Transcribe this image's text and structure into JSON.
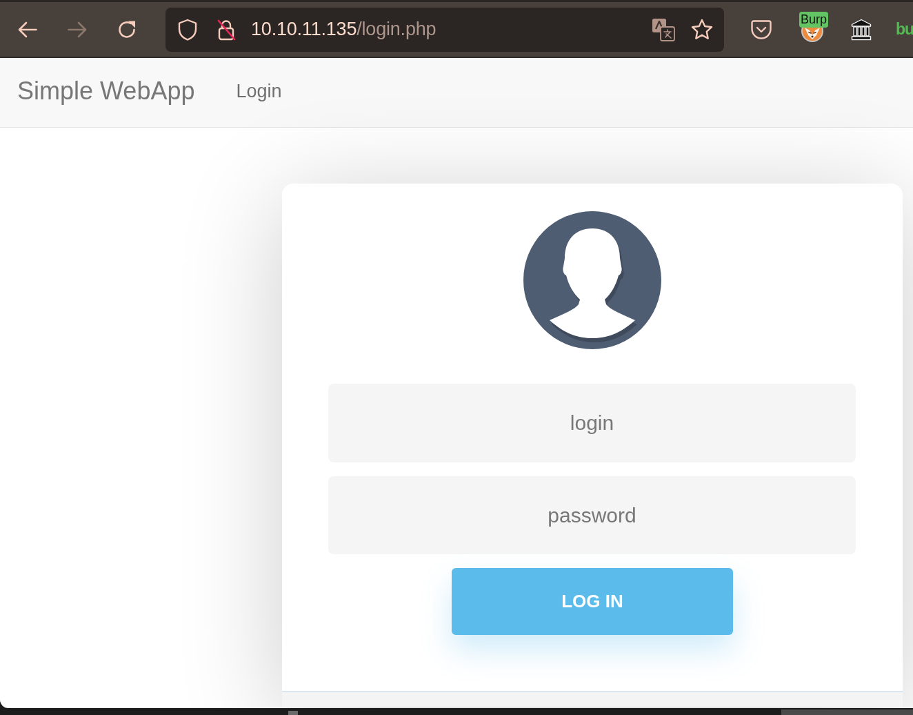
{
  "browser": {
    "nav_buttons": [
      {
        "kind": "back",
        "disabled": false
      },
      {
        "kind": "forward",
        "disabled": true
      },
      {
        "kind": "reload",
        "disabled": false
      }
    ],
    "url": {
      "host": "10.10.11.135",
      "path": "/login.php"
    },
    "extensions": [
      {
        "kind": "pouch"
      },
      {
        "kind": "fox",
        "badge": "Burp"
      },
      {
        "kind": "museum"
      },
      {
        "kind": "text",
        "label": "bu"
      }
    ]
  },
  "navbar": {
    "brand": "Simple WebApp",
    "links": [
      {
        "label": "Login"
      }
    ]
  },
  "login_card": {
    "fields": [
      {
        "placeholder": "login"
      },
      {
        "placeholder": "password"
      }
    ],
    "submit": "LOG IN"
  }
}
